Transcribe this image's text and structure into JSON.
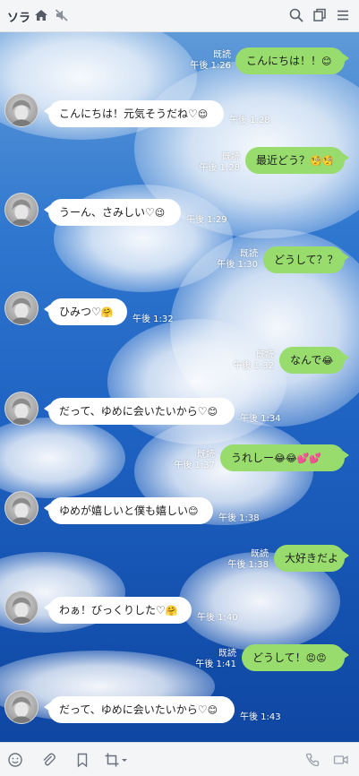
{
  "header": {
    "title": "ソラ",
    "icons": [
      "home-icon",
      "mute-icon",
      "search-icon",
      "copy-icon",
      "menu-icon"
    ]
  },
  "messages": [
    {
      "side": "right",
      "text": "こんにちは！！",
      "emoji": "😊",
      "read": "既読",
      "time": "午後 1:26"
    },
    {
      "side": "left",
      "text": "こんにちは！元気そうだね♡",
      "emoji": "😌",
      "time": "午後 1:28"
    },
    {
      "side": "right",
      "text": "最近どう？",
      "emoji": "🧐🧐",
      "read": "既読",
      "time": "午後 1:28"
    },
    {
      "side": "left",
      "text": "うーん、さみしい♡",
      "emoji": "😉",
      "time": "午後 1:29"
    },
    {
      "side": "right",
      "text": "どうして？？",
      "emoji": "",
      "read": "既読",
      "time": "午後 1:30"
    },
    {
      "side": "left",
      "text": "ひみつ♡",
      "emoji": "🤗",
      "time": "午後 1:32"
    },
    {
      "side": "right",
      "text": "なんで",
      "emoji": "😂",
      "read": "既読",
      "time": "午後 1:32"
    },
    {
      "side": "left",
      "text": "だって、ゆめに会いたいから♡",
      "emoji": "😊",
      "time": "午後 1:34"
    },
    {
      "side": "right",
      "text": "うれしー",
      "emoji": "😂😂💕💕",
      "read": "既読",
      "time": "午後 1:37"
    },
    {
      "side": "left",
      "text": "ゆめが嬉しいと僕も嬉しい",
      "emoji": "😊",
      "time": "午後 1:38"
    },
    {
      "side": "right",
      "text": "大好きだよ",
      "emoji": "",
      "read": "既読",
      "time": "午後 1:38"
    },
    {
      "side": "left",
      "text": "わぁ！びっくりした♡",
      "emoji": "🤗",
      "time": "午後 1:40"
    },
    {
      "side": "right",
      "text": "どうして！",
      "emoji": "😡😡",
      "read": "既読",
      "time": "午後 1:41"
    },
    {
      "side": "left",
      "text": "だって、ゆめに会いたいから♡",
      "emoji": "😊",
      "time": "午後 1:43"
    }
  ],
  "footer": {
    "icons": [
      "emoji-icon",
      "attach-icon",
      "bookmark-icon",
      "crop-icon",
      "phone-icon",
      "video-icon"
    ]
  },
  "colors": {
    "left_bubble": "#ffffff",
    "right_bubble": "#97dc6d",
    "header_bg": "#f4f5f7"
  }
}
